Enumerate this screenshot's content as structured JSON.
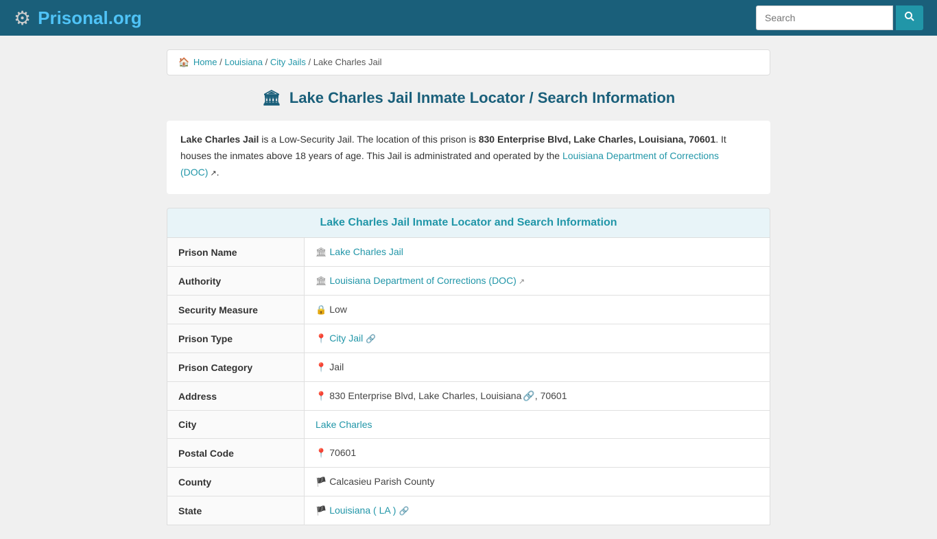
{
  "header": {
    "logo_text_main": "Prisonal",
    "logo_text_ext": ".org",
    "search_placeholder": "Search",
    "search_button_label": "🔍"
  },
  "breadcrumb": {
    "home": "Home",
    "louisiana": "Louisiana",
    "city_jails": "City Jails",
    "current": "Lake Charles Jail"
  },
  "page": {
    "title": "Lake Charles Jail Inmate Locator / Search Information",
    "description_part1": " is a Low-Security Jail. The location of this prison is ",
    "prison_name_bold": "Lake Charles Jail",
    "address_bold": "830 Enterprise Blvd, Lake Charles, Louisiana, 70601",
    "description_part2": ". It houses the inmates above 18 years of age. This Jail is administrated and operated by the ",
    "doc_link_text": "Louisiana Department of Corrections (DOC)",
    "description_end": ".",
    "section_header": "Lake Charles Jail Inmate Locator and Search Information"
  },
  "table": {
    "rows": [
      {
        "label": "Prison Name",
        "icon": "🏛",
        "value": "Lake Charles Jail",
        "link": true,
        "ext": false
      },
      {
        "label": "Authority",
        "icon": "🏛",
        "value": "Louisiana Department of Corrections (DOC)",
        "link": true,
        "ext": true
      },
      {
        "label": "Security Measure",
        "icon": "🔒",
        "value": "Low",
        "link": false,
        "ext": false
      },
      {
        "label": "Prison Type",
        "icon": "📍",
        "value": "City Jail",
        "link": true,
        "ext": false,
        "extra_icon": "🔗"
      },
      {
        "label": "Prison Category",
        "icon": "📍",
        "value": "Jail",
        "link": false,
        "ext": false
      },
      {
        "label": "Address",
        "icon": "📍",
        "value": "830 Enterprise Blvd, Lake Charles, Louisiana",
        "value2": ", 70601",
        "link": false,
        "state_link": true,
        "ext": false
      },
      {
        "label": "City",
        "icon": "",
        "value": "Lake Charles",
        "link": true,
        "ext": false
      },
      {
        "label": "Postal Code",
        "icon": "📍",
        "value": "70601",
        "link": false,
        "ext": false
      },
      {
        "label": "County",
        "icon": "🏴",
        "value": "Calcasieu Parish County",
        "link": false,
        "ext": false
      },
      {
        "label": "State",
        "icon": "🏴",
        "value": "Louisiana ( LA )",
        "link": true,
        "ext": false,
        "extra_icon": "🔗"
      }
    ]
  }
}
